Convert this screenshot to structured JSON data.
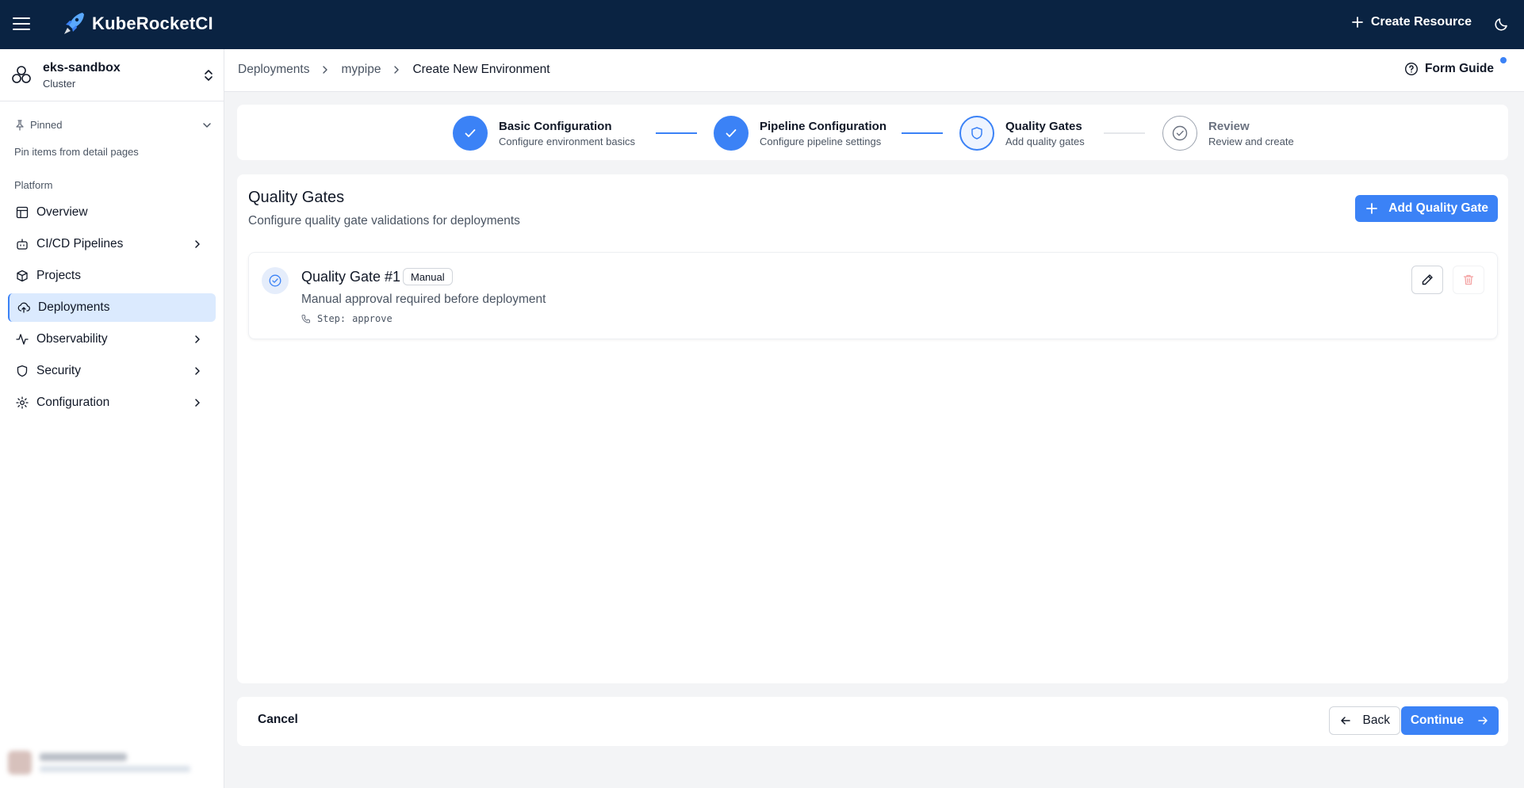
{
  "app": {
    "brand": "KubeRocketCI",
    "create_resource": "Create Resource"
  },
  "cluster": {
    "name": "eks-sandbox",
    "type": "Cluster"
  },
  "sidebar": {
    "pinned_label": "Pinned",
    "pinned_hint": "Pin items from detail pages",
    "section_label": "Platform",
    "items": [
      {
        "label": "Overview",
        "icon": "layout-icon",
        "has_children": false
      },
      {
        "label": "CI/CD Pipelines",
        "icon": "bot-icon",
        "has_children": true
      },
      {
        "label": "Projects",
        "icon": "box-icon",
        "has_children": false
      },
      {
        "label": "Deployments",
        "icon": "cloud-upload-icon",
        "has_children": false,
        "active": true
      },
      {
        "label": "Observability",
        "icon": "activity-icon",
        "has_children": true
      },
      {
        "label": "Security",
        "icon": "shield-icon",
        "has_children": true
      },
      {
        "label": "Configuration",
        "icon": "gear-icon",
        "has_children": true
      }
    ]
  },
  "breadcrumb": {
    "items": [
      "Deployments",
      "mypipe"
    ],
    "current": "Create New Environment"
  },
  "form_guide": {
    "label": "Form Guide"
  },
  "stepper": {
    "steps": [
      {
        "title": "Basic Configuration",
        "subtitle": "Configure environment basics",
        "status": "done"
      },
      {
        "title": "Pipeline Configuration",
        "subtitle": "Configure pipeline settings",
        "status": "done"
      },
      {
        "title": "Quality Gates",
        "subtitle": "Add quality gates",
        "status": "current"
      },
      {
        "title": "Review",
        "subtitle": "Review and create",
        "status": "todo"
      }
    ]
  },
  "quality_gates": {
    "title": "Quality Gates",
    "subtitle": "Configure quality gate validations for deployments",
    "add_button": "Add Quality Gate",
    "gates": [
      {
        "name": "Quality Gate #1",
        "type": "Manual",
        "description": "Manual approval required before deployment",
        "step_label": "Step:",
        "step_value": "approve"
      }
    ]
  },
  "footer": {
    "cancel": "Cancel",
    "back": "Back",
    "continue": "Continue"
  },
  "colors": {
    "topbar": "#0a2342",
    "accent": "#3b82f6",
    "active_nav": "#dbeafe"
  }
}
